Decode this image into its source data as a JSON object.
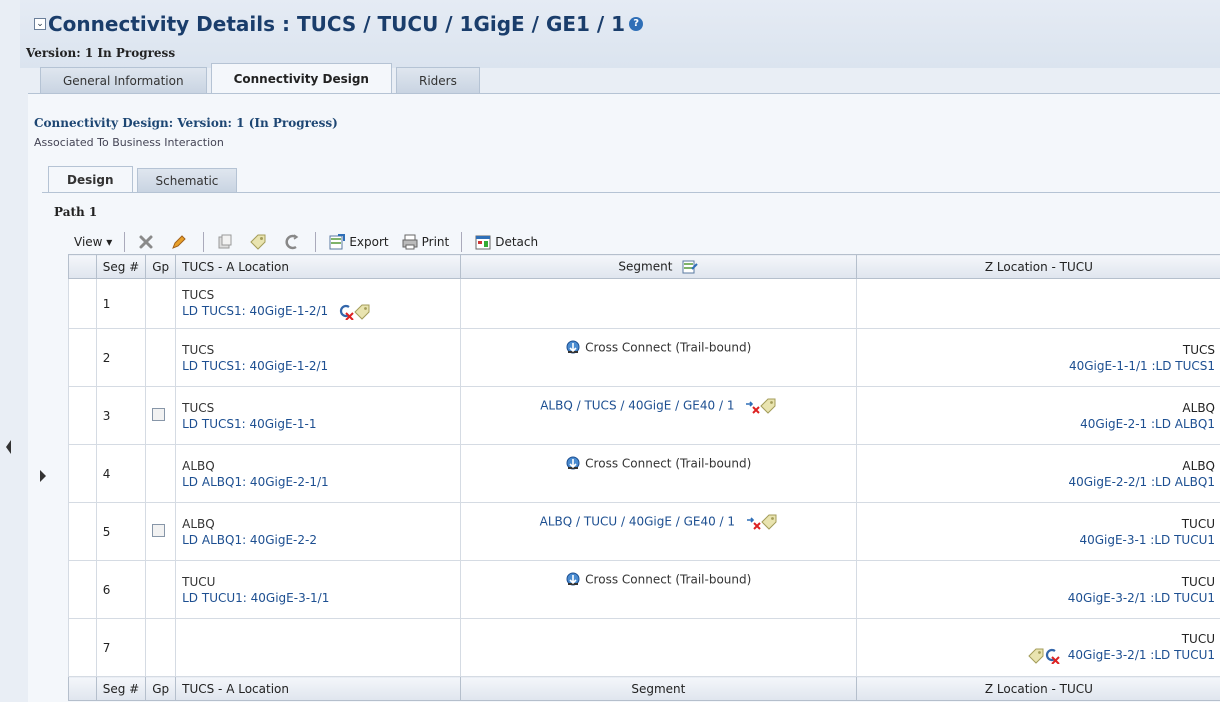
{
  "header": {
    "title": "Connectivity Details : TUCS / TUCU / 1GigE / GE1 / 1",
    "help_glyph": "?",
    "version": "Version: 1 In Progress"
  },
  "tabs": [
    {
      "label": "General Information",
      "active": false
    },
    {
      "label": "Connectivity Design",
      "active": true
    },
    {
      "label": "Riders",
      "active": false
    }
  ],
  "design": {
    "title": "Connectivity Design: Version: 1 (In Progress)",
    "subtitle": "Associated To Business Interaction",
    "subtabs": [
      {
        "label": "Design",
        "active": true
      },
      {
        "label": "Schematic",
        "active": false
      }
    ],
    "path_label": "Path 1"
  },
  "toolbar": {
    "view_label": "View ▾",
    "export_label": "Export",
    "print_label": "Print",
    "detach_label": "Detach"
  },
  "table": {
    "headers": [
      "Seg #",
      "Gp",
      "TUCS - A Location",
      "Segment",
      "Z Location - TUCU"
    ],
    "footer_headers": [
      "Seg #",
      "Gp",
      "TUCS - A Location",
      "Segment",
      "Z Location - TUCU"
    ],
    "rows": [
      {
        "seg": "1",
        "gp": false,
        "a_site": "TUCS",
        "a_port": "LD TUCS1: 40GigE-1-2/1",
        "segment": "",
        "segment_type": "none",
        "z_site": "",
        "z_port": ""
      },
      {
        "seg": "2",
        "gp": false,
        "a_site": "TUCS",
        "a_port": "LD TUCS1: 40GigE-1-2/1",
        "segment": "Cross Connect (Trail-bound)",
        "segment_type": "xc",
        "z_site": "TUCS",
        "z_port": "40GigE-1-1/1 :LD TUCS1"
      },
      {
        "seg": "3",
        "gp": true,
        "a_site": "TUCS",
        "a_port": "LD TUCS1: 40GigE-1-1",
        "segment": "ALBQ / TUCS / 40GigE / GE40 / 1",
        "segment_type": "link",
        "z_site": "ALBQ",
        "z_port": "40GigE-2-1 :LD ALBQ1"
      },
      {
        "seg": "4",
        "gp": false,
        "a_site": "ALBQ",
        "a_port": "LD ALBQ1: 40GigE-2-1/1",
        "segment": "Cross Connect (Trail-bound)",
        "segment_type": "xc",
        "z_site": "ALBQ",
        "z_port": "40GigE-2-2/1 :LD ALBQ1"
      },
      {
        "seg": "5",
        "gp": true,
        "a_site": "ALBQ",
        "a_port": "LD ALBQ1: 40GigE-2-2",
        "segment": "ALBQ / TUCU / 40GigE / GE40 / 1",
        "segment_type": "link",
        "z_site": "TUCU",
        "z_port": "40GigE-3-1 :LD TUCU1"
      },
      {
        "seg": "6",
        "gp": false,
        "a_site": "TUCU",
        "a_port": "LD TUCU1: 40GigE-3-1/1",
        "segment": "Cross Connect (Trail-bound)",
        "segment_type": "xc",
        "z_site": "TUCU",
        "z_port": "40GigE-3-2/1 :LD TUCU1"
      },
      {
        "seg": "7",
        "gp": false,
        "a_site": "",
        "a_port": "",
        "segment": "",
        "segment_type": "none",
        "z_site": "TUCU",
        "z_port": "40GigE-3-2/1 :LD TUCU1"
      }
    ]
  },
  "colors": {
    "link": "#1d4f91",
    "title": "#1a3d6b",
    "header_bg": "#dbe4ef"
  }
}
